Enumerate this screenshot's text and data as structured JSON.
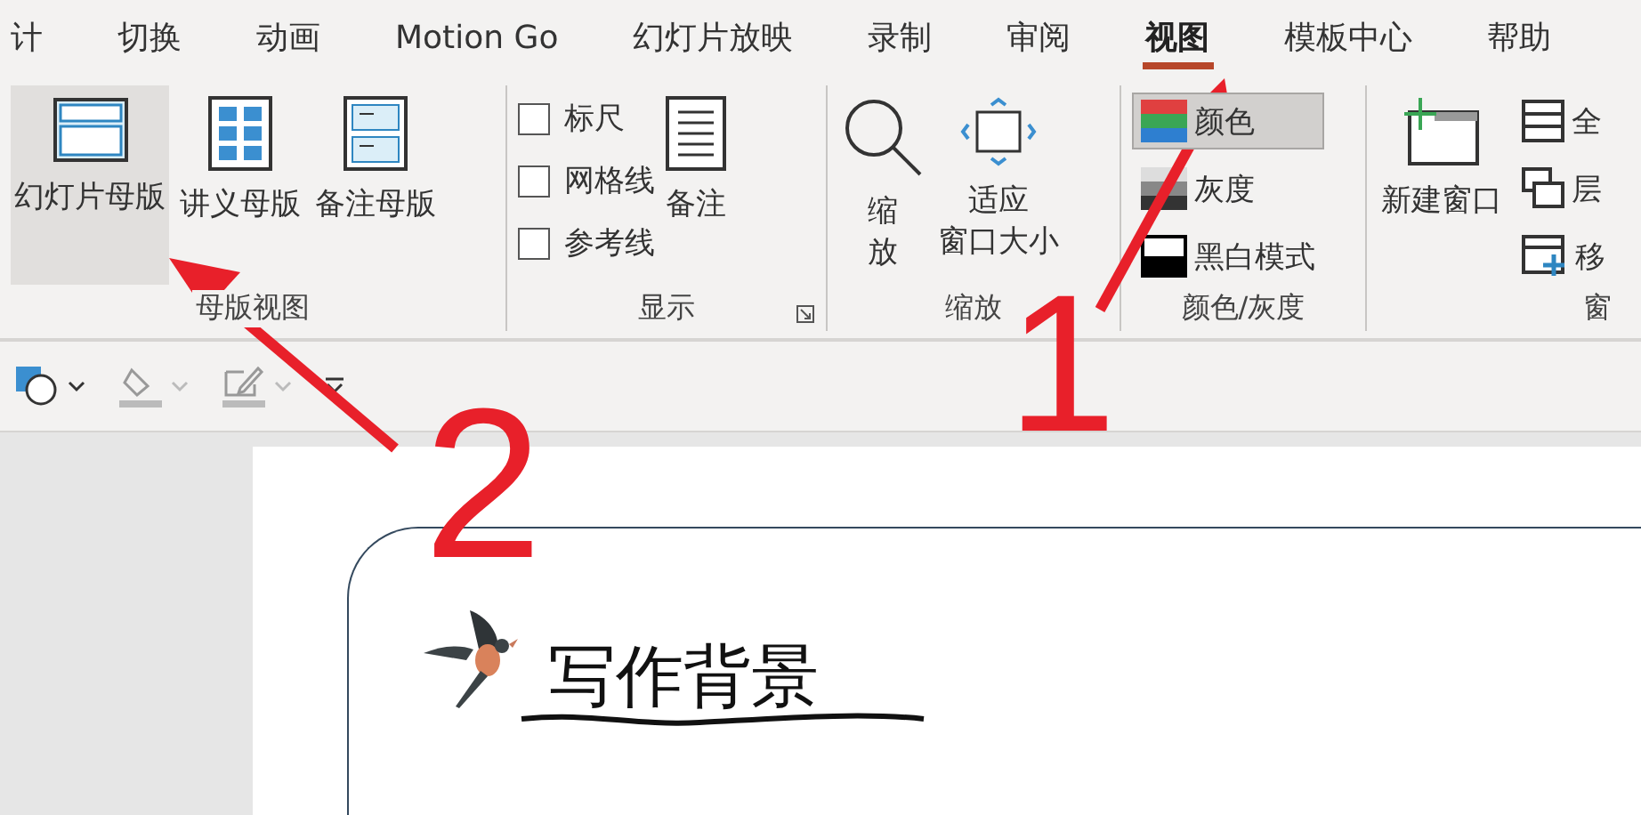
{
  "tabs": [
    {
      "label": "计",
      "selected": false
    },
    {
      "label": "切换",
      "selected": false
    },
    {
      "label": "动画",
      "selected": false
    },
    {
      "label": "Motion Go",
      "selected": false
    },
    {
      "label": "幻灯片放映",
      "selected": false
    },
    {
      "label": "录制",
      "selected": false
    },
    {
      "label": "审阅",
      "selected": false
    },
    {
      "label": "视图",
      "selected": true
    },
    {
      "label": "模板中心",
      "selected": false
    },
    {
      "label": "帮助",
      "selected": false
    }
  ],
  "ribbon": {
    "groups": [
      {
        "title": "母版视图",
        "items": [
          {
            "kind": "large",
            "lines": [
              "幻灯片母版"
            ],
            "selected": true
          },
          {
            "kind": "large",
            "lines": [
              "讲义母版"
            ],
            "selected": false
          },
          {
            "kind": "large",
            "lines": [
              "备注母版"
            ],
            "selected": false
          }
        ]
      },
      {
        "title": "显示",
        "launcher": true,
        "items": [
          {
            "kind": "check",
            "label": "标尺",
            "checked": false
          },
          {
            "kind": "check",
            "label": "网格线",
            "checked": false
          },
          {
            "kind": "check",
            "label": "参考线",
            "checked": false
          },
          {
            "kind": "large",
            "lines": [
              "备注"
            ],
            "selected": false
          }
        ]
      },
      {
        "title": "缩放",
        "items": [
          {
            "kind": "large",
            "lines": [
              "缩",
              "放"
            ],
            "selected": false
          },
          {
            "kind": "large",
            "lines": [
              "适应",
              "窗口大小"
            ],
            "selected": false
          }
        ]
      },
      {
        "title": "颜色/灰度",
        "items": [
          {
            "kind": "small",
            "label": "颜色",
            "selected": true
          },
          {
            "kind": "small",
            "label": "灰度",
            "selected": false
          },
          {
            "kind": "small",
            "label": "黑白模式",
            "selected": false
          }
        ]
      },
      {
        "title": "窗",
        "items": [
          {
            "kind": "large",
            "lines": [
              "新建窗口"
            ],
            "selected": false
          },
          {
            "kind": "small",
            "label": "全",
            "selected": false
          },
          {
            "kind": "small",
            "label": "层",
            "selected": false
          },
          {
            "kind": "small",
            "label": "移",
            "selected": false
          }
        ]
      }
    ]
  },
  "slide": {
    "title": "写作背景"
  },
  "annotations": [
    {
      "label": "1"
    },
    {
      "label": "2"
    }
  ]
}
